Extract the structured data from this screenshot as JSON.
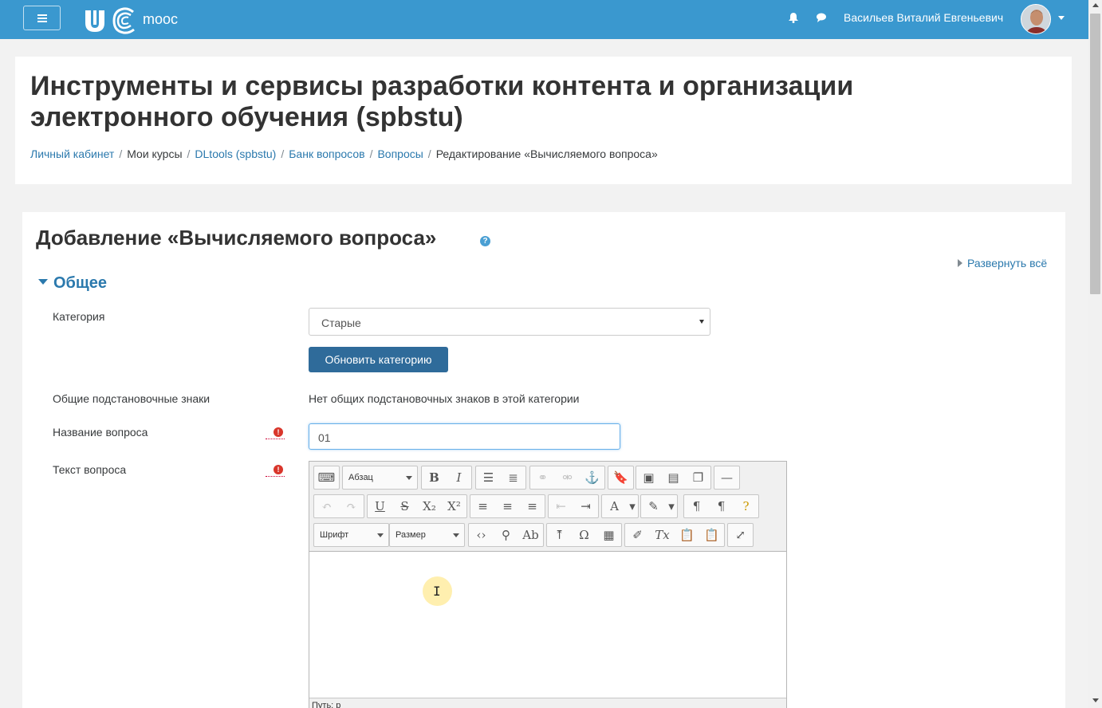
{
  "navbar": {
    "logo_text": "mooc",
    "user_name": "Васильев Виталий Евгеньевич",
    "color": "#3a98cf"
  },
  "header": {
    "course_title": "Инструменты и сервисы разработки контента и организации электронного обучения (spbstu)",
    "breadcrumb": [
      "Личный кабинет",
      "Мои курсы",
      "DLtools (spbstu)",
      "Банк вопросов",
      "Вопросы",
      "Редактирование «Вычисляемого вопроса»"
    ]
  },
  "form": {
    "heading": "Добавление «Вычисляемого вопроса»",
    "expand_all": "Развернуть всё",
    "section_general": "Общее",
    "category_label": "Категория",
    "category_value": "Старые",
    "update_category_button": "Обновить категорию",
    "wildcards_label": "Общие подстановочные знаки",
    "wildcards_value": "Нет общих подстановочных знаков в этой категории",
    "name_label": "Название вопроса",
    "name_value": "01",
    "text_label": "Текст вопроса"
  },
  "editor": {
    "paragraph_format": "Абзац",
    "font": "Шрифт",
    "size": "Размер",
    "status_path": "Путь: p"
  },
  "icons": [
    "menu-icon",
    "bell-icon",
    "chat-icon",
    "help-icon",
    "required-icon",
    "expand-caret-icon",
    "section-caret-icon"
  ]
}
